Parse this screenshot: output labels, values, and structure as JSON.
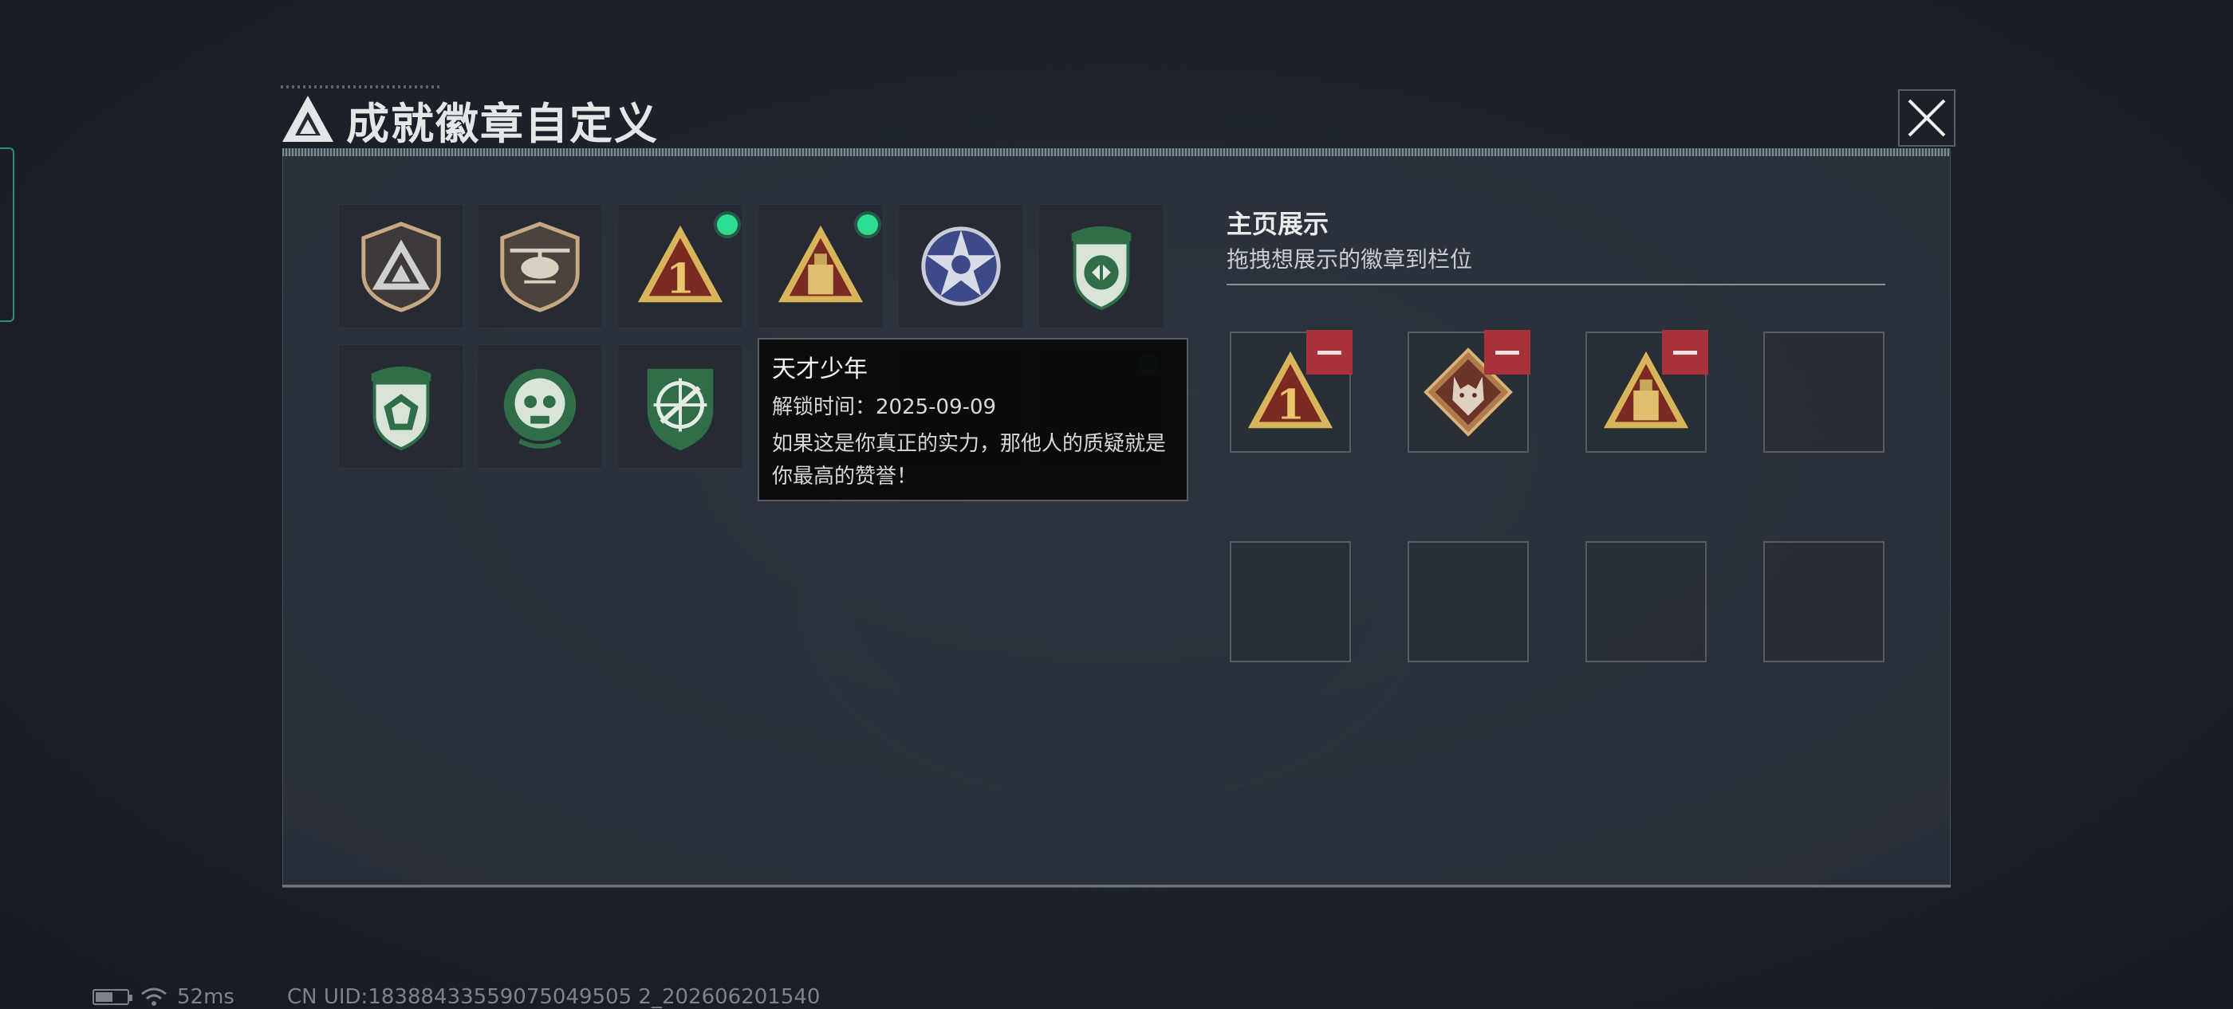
{
  "window": {
    "title": "成就徽章自定义"
  },
  "icons": {
    "close": "close-icon",
    "title_logo": "delta-logo-icon"
  },
  "colors": {
    "accent_green": "#2dde8e",
    "remove_red": "#a8323a",
    "panel": "#2e343d"
  },
  "badges": [
    {
      "name": "badge-delta-shield",
      "new": false
    },
    {
      "name": "badge-helicopter",
      "new": false
    },
    {
      "name": "badge-triangle-one",
      "new": true
    },
    {
      "name": "badge-triangle-usb",
      "new": true
    },
    {
      "name": "badge-star-blue",
      "new": false
    },
    {
      "name": "badge-green-shield-arrows",
      "new": false
    },
    {
      "name": "badge-green-shield-diamond",
      "new": false
    },
    {
      "name": "badge-green-skull",
      "new": false
    },
    {
      "name": "badge-green-crosshair",
      "new": false
    },
    {
      "name": "badge-hidden-1",
      "new": false
    },
    {
      "name": "badge-hidden-2",
      "new": true
    }
  ],
  "tooltip": {
    "title": "天才少年",
    "unlock_time": "解锁时间：2025-09-09",
    "description": "如果这是你真正的实力，那他人的质疑就是你最高的赞誉！"
  },
  "showcase": {
    "title": "主页展示",
    "subtitle": "拖拽想展示的徽章到栏位",
    "slots": [
      {
        "badge": "badge-triangle-one",
        "removable": true
      },
      {
        "badge": "badge-wolf-diamond",
        "removable": true
      },
      {
        "badge": "badge-triangle-usb",
        "removable": true
      },
      {
        "badge": "",
        "removable": false
      },
      {
        "badge": "",
        "removable": false
      },
      {
        "badge": "",
        "removable": false
      },
      {
        "badge": "",
        "removable": false
      },
      {
        "badge": "",
        "removable": false
      }
    ]
  },
  "status": {
    "battery_level": 0.55,
    "ping": "52ms",
    "uid": "CN UID:18388433559075049505 2_202606201540"
  }
}
